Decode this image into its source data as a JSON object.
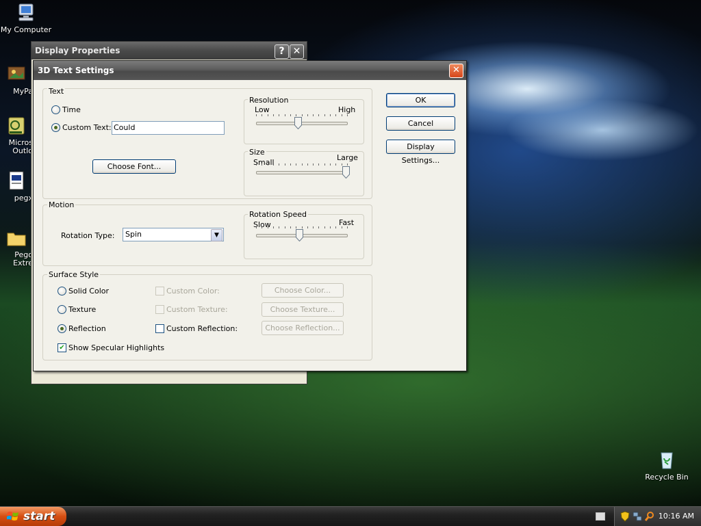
{
  "desktop": {
    "icons": [
      {
        "label": "My Computer"
      },
      {
        "label": "MyPa"
      },
      {
        "label": "Micros Outlo"
      },
      {
        "label": "pegx"
      },
      {
        "label": "Pego Extre"
      },
      {
        "label": "Recycle Bin"
      }
    ]
  },
  "display_properties": {
    "title": "Display Properties",
    "help": "?",
    "close": "✕"
  },
  "dialog": {
    "title": "3D Text Settings",
    "close": "✕",
    "text_group": {
      "title": "Text",
      "time_label": "Time",
      "custom_text_label": "Custom Text:",
      "custom_text_value": "Could",
      "selected": "custom_text",
      "choose_font": "Choose Font..."
    },
    "resolution": {
      "title": "Resolution",
      "low": "Low",
      "high": "High",
      "level": 0.45
    },
    "size": {
      "title": "Size",
      "small": "Small",
      "large": "Large",
      "level": 1.0
    },
    "motion": {
      "title": "Motion",
      "rotation_type_label": "Rotation Type:",
      "rotation_type_value": "Spin"
    },
    "rotation_speed": {
      "title": "Rotation Speed",
      "slow": "Slow",
      "fast": "Fast",
      "level": 0.47
    },
    "surface": {
      "title": "Surface Style",
      "solid_color": "Solid Color",
      "texture": "Texture",
      "reflection": "Reflection",
      "selected": "reflection",
      "custom_color": "Custom Color:",
      "custom_texture": "Custom Texture:",
      "custom_reflection": "Custom Reflection:",
      "choose_color": "Choose Color...",
      "choose_texture": "Choose Texture...",
      "choose_reflection": "Choose Reflection...",
      "show_specular": "Show Specular Highlights",
      "show_specular_checked": true
    },
    "buttons": {
      "ok": "OK",
      "cancel": "Cancel",
      "display_settings": "Display Settings..."
    }
  },
  "taskbar": {
    "start": "start",
    "clock": "10:16 AM"
  }
}
